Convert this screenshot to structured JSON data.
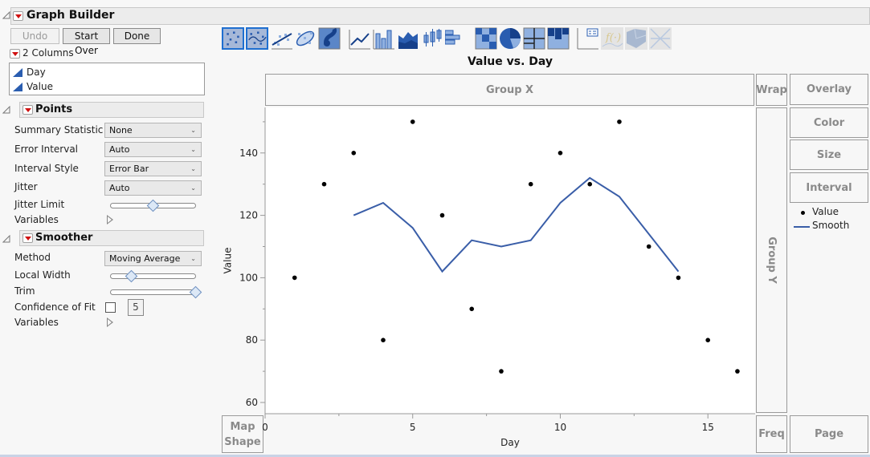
{
  "window": {
    "title": "Graph Builder"
  },
  "toolbar_buttons": {
    "undo": "Undo",
    "start_over": "Start Over",
    "done": "Done"
  },
  "columns_panel": {
    "header": "2 Columns",
    "items": [
      {
        "label": "Day",
        "icon": "continuous-column-icon"
      },
      {
        "label": "Value",
        "icon": "continuous-column-icon"
      }
    ]
  },
  "points_panel": {
    "header": "Points",
    "rows": [
      {
        "label": "Summary Statistic",
        "value": "None"
      },
      {
        "label": "Error Interval",
        "value": "Auto"
      },
      {
        "label": "Interval Style",
        "value": "Error Bar"
      },
      {
        "label": "Jitter",
        "value": "Auto"
      }
    ],
    "jitter_limit_label": "Jitter Limit",
    "jitter_limit_fraction": 0.5,
    "variables_label": "Variables"
  },
  "smoother_panel": {
    "header": "Smoother",
    "method_label": "Method",
    "method_value": "Moving Average",
    "local_width_label": "Local Width",
    "local_width_fraction": 0.25,
    "trim_label": "Trim",
    "trim_fraction": 1.0,
    "confidence_label": "Confidence of Fit",
    "confidence_checked": false,
    "confidence_value": "5",
    "variables_label": "Variables"
  },
  "element_icons": [
    {
      "name": "points-element-icon",
      "selected": true
    },
    {
      "name": "smoother-element-icon",
      "selected": true
    },
    {
      "name": "line-of-fit-element-icon",
      "selected": false
    },
    {
      "name": "ellipse-element-icon",
      "selected": false
    },
    {
      "name": "contour-element-icon",
      "selected": false
    },
    {
      "name": "line-element-icon",
      "selected": false
    },
    {
      "name": "bar-element-icon",
      "selected": false
    },
    {
      "name": "area-element-icon",
      "selected": false
    },
    {
      "name": "box-plot-element-icon",
      "selected": false
    },
    {
      "name": "histogram-element-icon",
      "selected": false
    },
    {
      "name": "heatmap-element-icon",
      "selected": false
    },
    {
      "name": "pie-element-icon",
      "selected": false
    },
    {
      "name": "treemap-element-icon",
      "selected": false
    },
    {
      "name": "mosaic-element-icon",
      "selected": false
    },
    {
      "name": "caption-box-element-icon",
      "selected": false
    },
    {
      "name": "formula-element-icon",
      "selected": false
    },
    {
      "name": "map-shapes-element-icon",
      "selected": false
    },
    {
      "name": "parallel-axis-element-icon",
      "selected": false
    }
  ],
  "drop_zones": {
    "group_x": "Group X",
    "group_y": "Group Y",
    "wrap": "Wrap",
    "overlay": "Overlay",
    "color": "Color",
    "size": "Size",
    "interval": "Interval",
    "freq": "Freq",
    "page": "Page",
    "map_shape": "Map Shape"
  },
  "legend": {
    "items": [
      {
        "label": "Value",
        "type": "marker"
      },
      {
        "label": "Smooth",
        "type": "line"
      }
    ]
  },
  "colors": {
    "smooth_line": "#3a5ea8",
    "point": "#000000",
    "selected_icon_border": "#1f6fd0",
    "dropdown_red": "#d01010"
  },
  "chart_data": {
    "type": "scatter",
    "title": "Value vs. Day",
    "xlabel": "Day",
    "ylabel": "Value",
    "xlim": [
      0,
      16.6
    ],
    "ylim": [
      56.4,
      154.6
    ],
    "xticks": [
      0,
      5,
      10,
      15
    ],
    "yticks": [
      60,
      80,
      100,
      120,
      140
    ],
    "grid": false,
    "legend_position": "right",
    "series": [
      {
        "name": "Value",
        "type": "scatter",
        "x": [
          1,
          2,
          3,
          4,
          5,
          6,
          7,
          8,
          9,
          10,
          11,
          12,
          13,
          14,
          15,
          16
        ],
        "y": [
          100,
          130,
          140,
          80,
          150,
          120,
          90,
          70,
          130,
          140,
          130,
          150,
          110,
          100,
          80,
          70
        ]
      },
      {
        "name": "Smooth",
        "type": "line",
        "x": [
          3,
          4,
          5,
          6,
          7,
          8,
          9,
          10,
          11,
          12,
          13,
          14
        ],
        "y": [
          120,
          124,
          116,
          102,
          112,
          110,
          112,
          124,
          132,
          126,
          114,
          102
        ]
      }
    ]
  }
}
